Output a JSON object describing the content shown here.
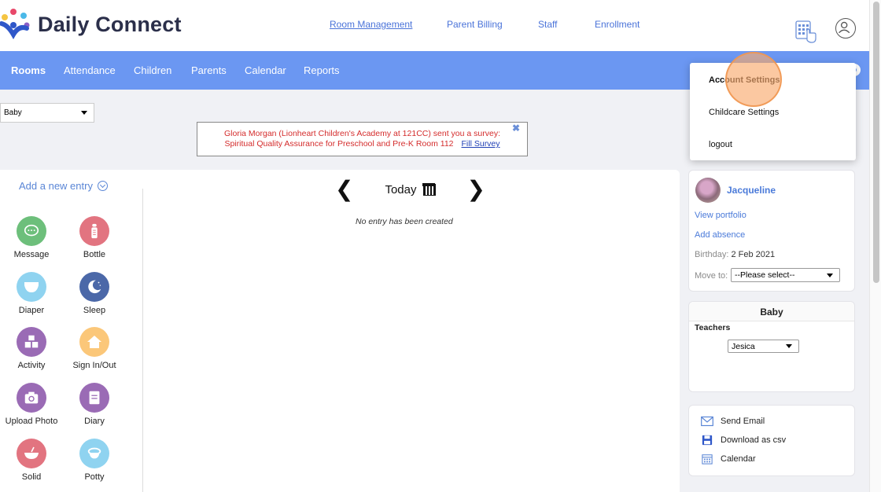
{
  "app": {
    "name": "Daily Connect"
  },
  "topnav": [
    {
      "label": "Room Management"
    },
    {
      "label": "Parent Billing"
    },
    {
      "label": "Staff"
    },
    {
      "label": "Enrollment"
    }
  ],
  "tabs": [
    {
      "label": "Rooms"
    },
    {
      "label": "Attendance"
    },
    {
      "label": "Children"
    },
    {
      "label": "Parents"
    },
    {
      "label": "Calendar"
    },
    {
      "label": "Reports"
    }
  ],
  "room_selector": {
    "value": "Baby"
  },
  "survey_banner": {
    "line1": "Gloria Morgan (Lionheart Children's Academy at 121CC) sent you a survey:",
    "line2": "Spiritual Quality Assurance for Preschool and Pre-K Room 112",
    "link": "Fill Survey",
    "close": "✖"
  },
  "entry_panel": {
    "add_label": "Add a new entry",
    "entries": [
      {
        "label": "Message",
        "color": "#6dbf7b",
        "icon": "message-icon"
      },
      {
        "label": "Bottle",
        "color": "#e27480",
        "icon": "bottle-icon"
      },
      {
        "label": "Diaper",
        "color": "#8fd3f0",
        "icon": "diaper-icon"
      },
      {
        "label": "Sleep",
        "color": "#4b68a8",
        "icon": "sleep-icon"
      },
      {
        "label": "Activity",
        "color": "#9a6bb5",
        "icon": "activity-icon"
      },
      {
        "label": "Sign In/Out",
        "color": "#fbc779",
        "icon": "home-icon"
      },
      {
        "label": "Upload Photo",
        "color": "#9a6bb5",
        "icon": "camera-icon"
      },
      {
        "label": "Diary",
        "color": "#9a6bb5",
        "icon": "diary-icon"
      },
      {
        "label": "Solid",
        "color": "#e27480",
        "icon": "bowl-icon"
      },
      {
        "label": "Potty",
        "color": "#8fd3f0",
        "icon": "potty-icon"
      }
    ]
  },
  "day_nav": {
    "label": "Today",
    "prev": "❮",
    "next": "❯"
  },
  "empty_state": "No entry has been created",
  "child_card": {
    "name": "Jacqueline",
    "view_portfolio": "View portfolio",
    "add_absence": "Add absence",
    "birthday_label": "Birthday:",
    "birthday_value": "2 Feb 2021",
    "move_label": "Move to:",
    "move_value": "--Please select--"
  },
  "room_card": {
    "title": "Baby",
    "teachers_label": "Teachers",
    "teacher_value": "Jesica"
  },
  "actions": [
    {
      "label": "Send Email",
      "icon": "envelope-icon"
    },
    {
      "label": "Download as csv",
      "icon": "save-icon"
    },
    {
      "label": "Calendar",
      "icon": "calendar-icon"
    }
  ],
  "account_menu": [
    {
      "label": "Account Settings"
    },
    {
      "label": "Childcare Settings"
    },
    {
      "label": "logout"
    }
  ],
  "colors": {
    "accent": "#6b97f2",
    "link": "#4a73d9",
    "alert": "#d42c2c"
  }
}
